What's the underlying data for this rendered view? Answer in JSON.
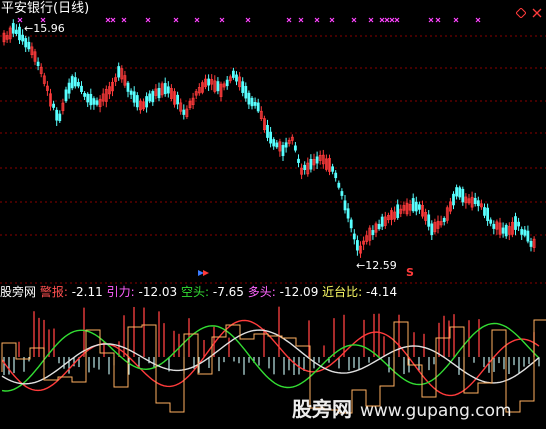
{
  "header": {
    "title": "平安银行(日线)"
  },
  "window_controls": {
    "diamond_icon": "◇",
    "close_icon": "✕"
  },
  "price_panel": {
    "high_label": "15.96",
    "low_label": "12.59",
    "marker_s": "S"
  },
  "indicator": {
    "name": "股旁网",
    "items": [
      {
        "label": "警报:",
        "value": "-2.11",
        "color": "#ff5050"
      },
      {
        "label": "引力:",
        "value": "-12.03",
        "color": "#ff60ff"
      },
      {
        "label": "空头:",
        "value": "-7.65",
        "color": "#33dd33"
      },
      {
        "label": "多头:",
        "value": "-12.09",
        "color": "#ff66ff"
      },
      {
        "label": "近台比:",
        "value": "-4.14",
        "color": "#ffff66"
      }
    ]
  },
  "watermark": {
    "cn": "股旁网",
    "url": "www.gupang.com"
  },
  "colors": {
    "up": "#ff3b3b",
    "down": "#58ffff",
    "grid": "#8a0000",
    "cross": "#ff44ff"
  }
}
